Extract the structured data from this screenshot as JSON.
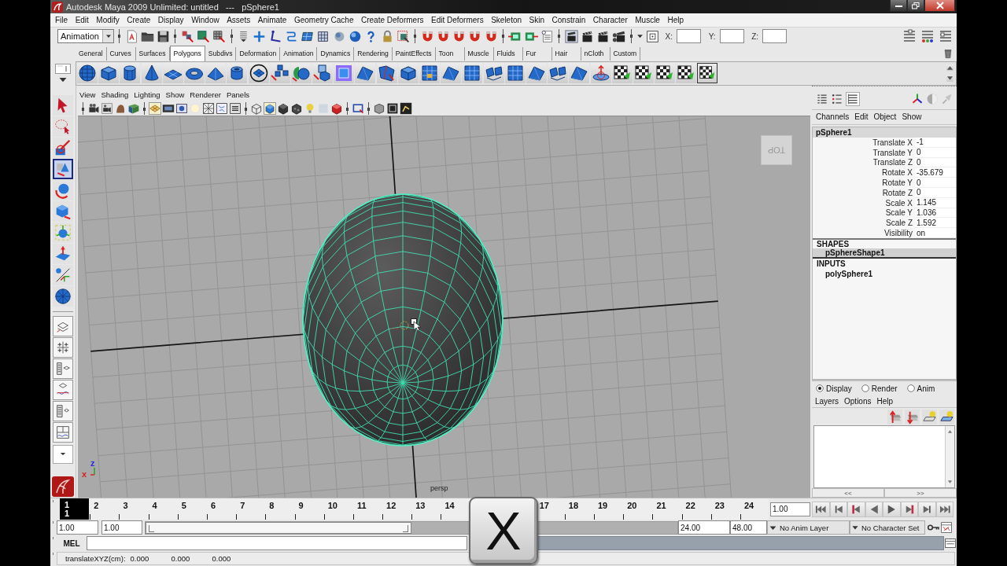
{
  "window": {
    "title": "Autodesk Maya 2009 Unlimited: untitled   ---   pSphere1"
  },
  "menu_bar": [
    "File",
    "Edit",
    "Modify",
    "Create",
    "Display",
    "Window",
    "Assets",
    "Animate",
    "Geometry Cache",
    "Create Deformers",
    "Edit Deformers",
    "Skeleton",
    "Skin",
    "Constrain",
    "Character",
    "Muscle",
    "Help"
  ],
  "status_line": {
    "menu_set": "Animation",
    "coordinates": [
      {
        "label": "X:"
      },
      {
        "label": "Y:"
      },
      {
        "label": "Z:"
      }
    ]
  },
  "shelf": {
    "tabs": [
      {
        "label": "General",
        "selected": false
      },
      {
        "label": "Curves",
        "selected": false
      },
      {
        "label": "Surfaces",
        "selected": false
      },
      {
        "label": "Polygons",
        "selected": true
      },
      {
        "label": "Subdivs",
        "selected": false
      },
      {
        "label": "Deformation",
        "selected": false
      },
      {
        "label": "Animation",
        "selected": false
      },
      {
        "label": "Dynamics",
        "selected": false
      },
      {
        "label": "Rendering",
        "selected": false
      },
      {
        "label": "PaintEffects",
        "selected": false
      },
      {
        "label": "Toon",
        "selected": false
      },
      {
        "label": "Muscle",
        "selected": false
      },
      {
        "label": "Fluids",
        "selected": false
      },
      {
        "label": "Fur",
        "selected": false
      },
      {
        "label": "Hair",
        "selected": false
      },
      {
        "label": "nCloth",
        "selected": false
      },
      {
        "label": "Custom",
        "selected": false
      }
    ]
  },
  "toolbox": {
    "tools": [
      {
        "kind": "select",
        "selected": false
      },
      {
        "kind": "lasso",
        "selected": false
      },
      {
        "kind": "paint",
        "selected": false
      },
      {
        "kind": "move",
        "selected": true
      },
      {
        "kind": "rotate",
        "selected": false
      },
      {
        "kind": "scale",
        "selected": false
      },
      {
        "kind": "universal",
        "selected": false
      },
      {
        "kind": "softmod",
        "selected": false
      },
      {
        "kind": "manipulator",
        "selected": false
      },
      {
        "kind": "recent",
        "selected": false
      }
    ]
  },
  "viewport": {
    "menu": [
      "View",
      "Shading",
      "Lighting",
      "Show",
      "Renderer",
      "Panels"
    ],
    "view_cube": "TOP",
    "axis_labels": [
      {
        "label": "z",
        "color": "#2828d8"
      },
      {
        "label": "x",
        "color": "#d82020"
      }
    ],
    "camera": "persp"
  },
  "channel_box": {
    "menu": [
      "Channels",
      "Edit",
      "Object",
      "Show"
    ],
    "object": "pSphere1",
    "channels": [
      {
        "name": "Translate X",
        "value": "-1"
      },
      {
        "name": "Translate Y",
        "value": "0"
      },
      {
        "name": "Translate Z",
        "value": "0"
      },
      {
        "name": "Rotate X",
        "value": "-35.679"
      },
      {
        "name": "Rotate Y",
        "value": "0"
      },
      {
        "name": "Rotate Z",
        "value": "0"
      },
      {
        "name": "Scale X",
        "value": "1.145"
      },
      {
        "name": "Scale Y",
        "value": "1.036"
      },
      {
        "name": "Scale Z",
        "value": "1.592"
      },
      {
        "name": "Visibility",
        "value": "on"
      }
    ],
    "shapes_heading": "SHAPES",
    "shapes": [
      {
        "label": "pSphereShape1",
        "selected": true
      }
    ],
    "inputs_heading": "INPUTS",
    "inputs": [
      {
        "label": "polySphere1",
        "selected": false
      }
    ]
  },
  "layer_editor": {
    "modes": [
      {
        "label": "Display",
        "selected": true
      },
      {
        "label": "Render",
        "selected": false
      },
      {
        "label": "Anim",
        "selected": false
      }
    ],
    "menu": [
      "Layers",
      "Options",
      "Help"
    ],
    "pager": [
      "<<",
      ">>"
    ]
  },
  "time_slider": {
    "frames_left": [
      {
        "label": "1",
        "selected": true
      },
      {
        "label": "2",
        "selected": false
      },
      {
        "label": "3",
        "selected": false
      },
      {
        "label": "4",
        "selected": false
      },
      {
        "label": "5",
        "selected": false
      },
      {
        "label": "6",
        "selected": false
      },
      {
        "label": "7",
        "selected": false
      },
      {
        "label": "8",
        "selected": false
      },
      {
        "label": "9",
        "selected": false
      },
      {
        "label": "10",
        "selected": false
      },
      {
        "label": "11",
        "selected": false
      },
      {
        "label": "12",
        "selected": false
      },
      {
        "label": "13",
        "selected": false
      },
      {
        "label": "14",
        "selected": false
      }
    ],
    "frames_right": [
      {
        "label": "17",
        "selected": false
      },
      {
        "label": "18",
        "selected": false
      },
      {
        "label": "19",
        "selected": false
      },
      {
        "label": "20",
        "selected": false
      },
      {
        "label": "21",
        "selected": false
      },
      {
        "label": "22",
        "selected": false
      },
      {
        "label": "23",
        "selected": false
      },
      {
        "label": "24",
        "selected": false
      }
    ],
    "current_frame": "1",
    "current_time": "1.00"
  },
  "range_slider": {
    "start_time": "1.00",
    "playback_start": "1.00",
    "level": 0.5,
    "playback_end": "24.00",
    "end_time": "48.00",
    "anim_layer": "No Anim Layer",
    "character_set": "No Character Set"
  },
  "command_line": {
    "language": "MEL"
  },
  "help_line": {
    "label": "translateXYZ(cm):",
    "values": [
      "0.000",
      "0.000",
      "0.000"
    ]
  },
  "key_overlay": {
    "key": "X"
  }
}
